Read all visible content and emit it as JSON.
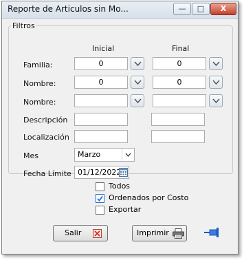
{
  "window": {
    "title": "Reporte de Articulos sin Mo...",
    "minimize_label": "—",
    "maximize_label": "□",
    "close_label": "X"
  },
  "filters": {
    "group_label": "Filtros",
    "col_initial": "Inicial",
    "col_final": "Final",
    "familia": {
      "label": "Familia:",
      "initial": "0",
      "final": "0"
    },
    "nombre1": {
      "label": "Nombre:",
      "initial": "0",
      "final": "0"
    },
    "nombre2": {
      "label": "Nombre:",
      "initial": "",
      "final": ""
    },
    "descripcion": {
      "label": "Descripción",
      "initial": "",
      "final": ""
    },
    "localizacion": {
      "label": "Localización",
      "initial": "",
      "final": ""
    },
    "mes": {
      "label": "Mes",
      "selected": "Marzo"
    },
    "fecha_limite": {
      "label": "Fecha Límite",
      "value": "01/12/2022"
    }
  },
  "options": {
    "todos": {
      "label": "Todos",
      "checked": false
    },
    "ordenados": {
      "label": "Ordenados por Costo",
      "checked": true
    },
    "exportar": {
      "label": "Exportar",
      "checked": false
    }
  },
  "buttons": {
    "salir": "Salir",
    "imprimir": "Imprimir"
  },
  "colors": {
    "check_accent": "#1e6fd9",
    "close_red": "#c7412a",
    "pin_blue": "#1b57c4"
  }
}
